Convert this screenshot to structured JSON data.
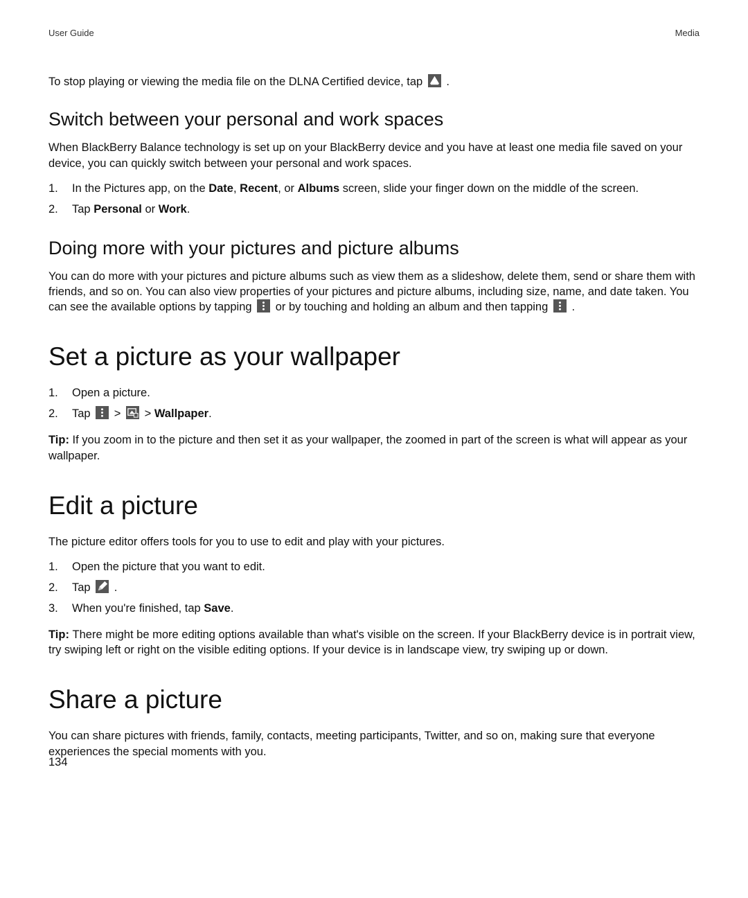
{
  "header": {
    "left": "User Guide",
    "right": "Media"
  },
  "intro_line": {
    "before_icon": "To stop playing or viewing the media file on the DLNA Certified device, tap ",
    "after_icon": "."
  },
  "section_switch": {
    "heading": "Switch between your personal and work spaces",
    "para": "When BlackBerry Balance technology is set up on your BlackBerry device and you have at least one media file saved on your device, you can quickly switch between your personal and work spaces.",
    "steps": {
      "s1": {
        "pre": "In the Pictures app, on the ",
        "b1": "Date",
        "sep1": ", ",
        "b2": "Recent",
        "sep2": ", or ",
        "b3": "Albums",
        "post": " screen, slide your finger down on the middle of the screen."
      },
      "s2": {
        "pre": "Tap ",
        "b1": "Personal",
        "sep": " or ",
        "b2": "Work",
        "post": "."
      }
    }
  },
  "section_doingmore": {
    "heading": "Doing more with your pictures and picture albums",
    "para": {
      "p1": "You can do more with your pictures and picture albums such as view them as a slideshow, delete them, send or share them with friends, and so on. You can also view properties of your pictures and picture albums, including size, name, and date taken. You can see the available options by tapping ",
      "mid": " or by touching and holding an album and then tapping ",
      "end": "."
    }
  },
  "section_wallpaper": {
    "heading": "Set a picture as your wallpaper",
    "steps": {
      "s1": "Open a picture.",
      "s2": {
        "pre": "Tap ",
        "sep1": " > ",
        "sep2": " > ",
        "bold": "Wallpaper",
        "post": "."
      }
    },
    "tip": {
      "label": "Tip: ",
      "text": "If you zoom in to the picture and then set it as your wallpaper, the zoomed in part of the screen is what will appear as your wallpaper."
    }
  },
  "section_edit": {
    "heading": "Edit a picture",
    "para": "The picture editor offers tools for you to use to edit and play with your pictures.",
    "steps": {
      "s1": "Open the picture that you want to edit.",
      "s2": {
        "pre": "Tap ",
        "post": "."
      },
      "s3": {
        "pre": "When you're finished, tap ",
        "bold": "Save",
        "post": "."
      }
    },
    "tip": {
      "label": "Tip: ",
      "text": "There might be more editing options available than what's visible on the screen. If your BlackBerry device is in portrait view, try swiping left or right on the visible editing options. If your device is in landscape view, try swiping up or down."
    }
  },
  "section_share": {
    "heading": "Share a picture",
    "para": "You can share pictures with friends, family, contacts, meeting participants, Twitter, and so on, making sure that everyone experiences the special moments with you."
  },
  "page_number": "134",
  "nums": {
    "n1": "1.",
    "n2": "2.",
    "n3": "3."
  }
}
